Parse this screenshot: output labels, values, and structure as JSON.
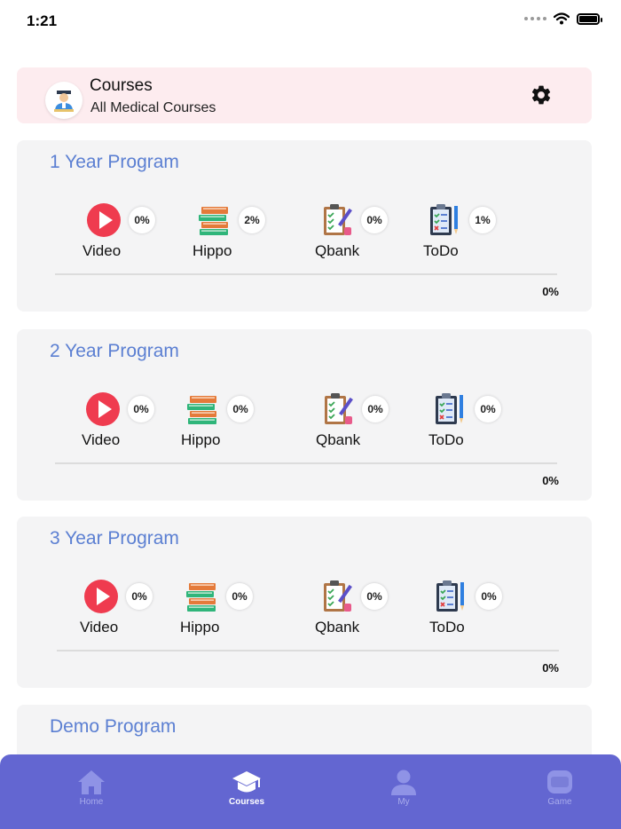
{
  "status_bar": {
    "time": "1:21"
  },
  "header": {
    "title": "Courses",
    "subtitle": "All Medical Courses"
  },
  "programs": [
    {
      "title": "1 Year Program",
      "modules": [
        {
          "label": "Video",
          "icon": "play-video-icon",
          "progress": "0%"
        },
        {
          "label": "Hippo",
          "icon": "books-icon",
          "progress": "2%"
        },
        {
          "label": "Qbank",
          "icon": "clipboard-pencil-icon",
          "progress": "0%"
        },
        {
          "label": "ToDo",
          "icon": "checklist-icon",
          "progress": "1%"
        }
      ],
      "overall": "0%"
    },
    {
      "title": "2 Year Program",
      "modules": [
        {
          "label": "Video",
          "icon": "play-video-icon",
          "progress": "0%"
        },
        {
          "label": "Hippo",
          "icon": "books-icon",
          "progress": "0%"
        },
        {
          "label": "Qbank",
          "icon": "clipboard-pencil-icon",
          "progress": "0%"
        },
        {
          "label": "ToDo",
          "icon": "checklist-icon",
          "progress": "0%"
        }
      ],
      "overall": "0%"
    },
    {
      "title": "3 Year Program",
      "modules": [
        {
          "label": "Video",
          "icon": "play-video-icon",
          "progress": "0%"
        },
        {
          "label": "Hippo",
          "icon": "books-icon",
          "progress": "0%"
        },
        {
          "label": "Qbank",
          "icon": "clipboard-pencil-icon",
          "progress": "0%"
        },
        {
          "label": "ToDo",
          "icon": "checklist-icon",
          "progress": "0%"
        }
      ],
      "overall": "0%"
    },
    {
      "title": "Demo Program"
    }
  ],
  "tabs": [
    {
      "label": "Home",
      "icon": "home-icon",
      "active": false
    },
    {
      "label": "Courses",
      "icon": "graduation-cap-icon",
      "active": true
    },
    {
      "label": "My",
      "icon": "user-icon",
      "active": false
    },
    {
      "label": "Game",
      "icon": "game-icon",
      "active": false
    }
  ],
  "colors": {
    "accent": "#5b7fd2",
    "tab_bar": "#6366d1",
    "header_bg": "#fdecef",
    "card_bg": "#f4f4f5"
  }
}
